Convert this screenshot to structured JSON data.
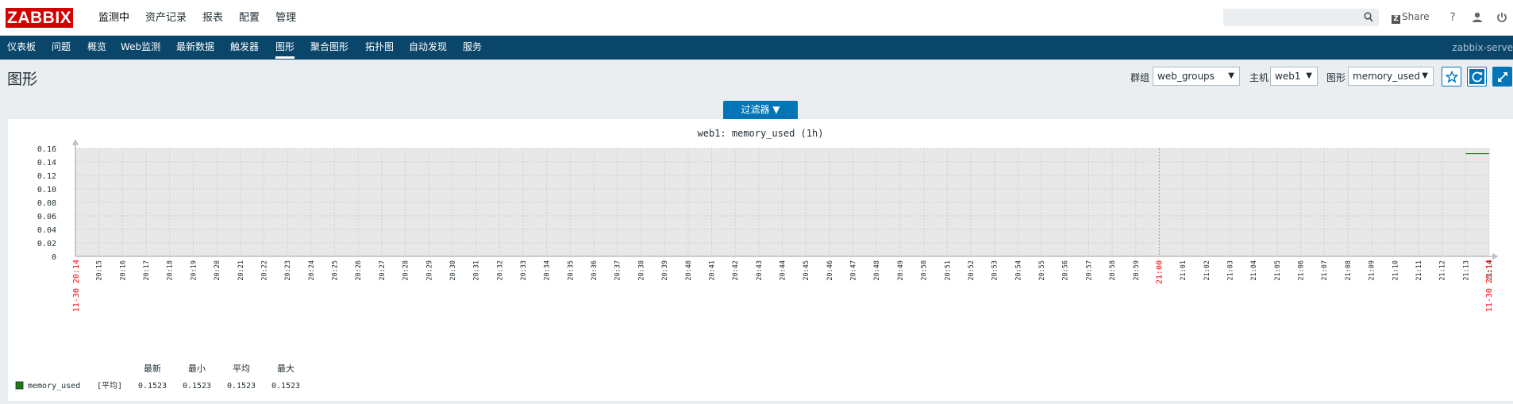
{
  "logo": "ZABBIX",
  "top_menu": [
    "监测中",
    "资产记录",
    "报表",
    "配置",
    "管理"
  ],
  "share_label": "Share",
  "help_glyph": "?",
  "search": {
    "value": "",
    "placeholder": ""
  },
  "nav": {
    "items": [
      "仪表板",
      "问题",
      "概览",
      "Web监测",
      "最新数据",
      "触发器",
      "图形",
      "聚合图形",
      "拓扑图",
      "自动发现",
      "服务"
    ],
    "active": "图形",
    "server": "zabbix-serve"
  },
  "page_title": "图形",
  "filters": {
    "group_label": "群组",
    "group_value": "web_groups",
    "host_label": "主机",
    "host_value": "web1",
    "graph_label": "图形",
    "graph_value": "memory_used"
  },
  "filter_tab": "过滤器 ▼",
  "icons": [
    "search-icon",
    "share-icon",
    "help-icon",
    "user-icon",
    "power-icon",
    "star-icon",
    "refresh-icon",
    "fullscreen-icon"
  ],
  "colors": {
    "nav_bg": "#0a466a",
    "accent": "#0275b8",
    "logo": "#d40000",
    "series": "#1a7c11",
    "period_label": "#ff0000"
  },
  "chart_data": {
    "type": "line",
    "title": "web1: memory_used (1h)",
    "y_ticks": [
      "0.16",
      "0.14",
      "0.12",
      "0.10",
      "0.08",
      "0.06",
      "0.04",
      "0.02",
      "0"
    ],
    "ylim": [
      0,
      0.16
    ],
    "x_start_label": "11-30 20:14",
    "x_end_label": "11-30 21:14",
    "x_ticks": [
      "20:15",
      "20:16",
      "20:17",
      "20:18",
      "20:19",
      "20:20",
      "20:21",
      "20:22",
      "20:23",
      "20:24",
      "20:25",
      "20:26",
      "20:27",
      "20:28",
      "20:29",
      "20:30",
      "20:31",
      "20:32",
      "20:33",
      "20:34",
      "20:35",
      "20:36",
      "20:37",
      "20:38",
      "20:39",
      "20:40",
      "20:41",
      "20:42",
      "20:43",
      "20:44",
      "20:45",
      "20:46",
      "20:47",
      "20:48",
      "20:49",
      "20:50",
      "20:51",
      "20:52",
      "20:53",
      "20:54",
      "20:55",
      "20:56",
      "20:57",
      "20:58",
      "20:59",
      "21:00",
      "21:01",
      "21:02",
      "21:03",
      "21:04",
      "21:05",
      "21:06",
      "21:07",
      "21:08",
      "21:09",
      "21:10",
      "21:11",
      "21:12",
      "21:13",
      "21:14"
    ],
    "highlight_tick": "21:00",
    "series": [
      {
        "name": "memory_used",
        "color": "#1a7c11",
        "x": [
          "21:13",
          "21:14"
        ],
        "values": [
          0.1523,
          0.1523
        ]
      }
    ],
    "legend": {
      "headers": [
        "最新",
        "最小",
        "平均",
        "最大"
      ],
      "name": "memory_used",
      "func": "[平均]",
      "latest": "0.1523",
      "min": "0.1523",
      "avg": "0.1523",
      "max": "0.1523"
    }
  }
}
